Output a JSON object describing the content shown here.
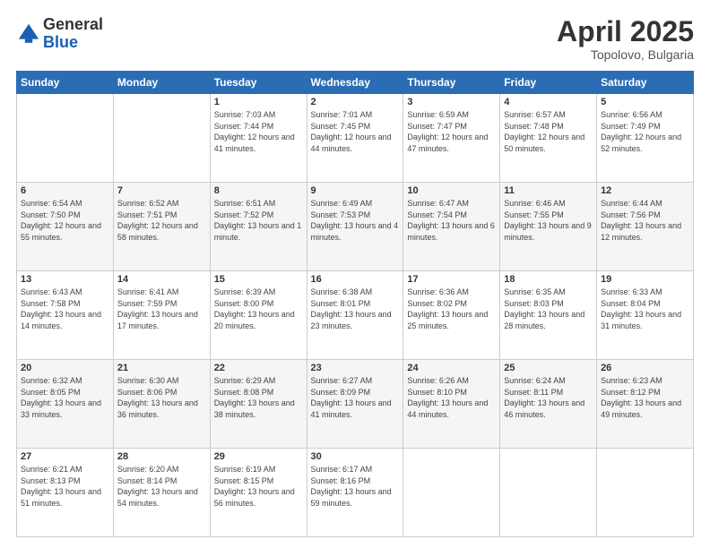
{
  "header": {
    "logo": {
      "general": "General",
      "blue": "Blue"
    },
    "title": "April 2025",
    "subtitle": "Topolovo, Bulgaria"
  },
  "days_of_week": [
    "Sunday",
    "Monday",
    "Tuesday",
    "Wednesday",
    "Thursday",
    "Friday",
    "Saturday"
  ],
  "weeks": [
    [
      {
        "day": "",
        "sunrise": "",
        "sunset": "",
        "daylight": ""
      },
      {
        "day": "",
        "sunrise": "",
        "sunset": "",
        "daylight": ""
      },
      {
        "day": "1",
        "sunrise": "Sunrise: 7:03 AM",
        "sunset": "Sunset: 7:44 PM",
        "daylight": "Daylight: 12 hours and 41 minutes."
      },
      {
        "day": "2",
        "sunrise": "Sunrise: 7:01 AM",
        "sunset": "Sunset: 7:45 PM",
        "daylight": "Daylight: 12 hours and 44 minutes."
      },
      {
        "day": "3",
        "sunrise": "Sunrise: 6:59 AM",
        "sunset": "Sunset: 7:47 PM",
        "daylight": "Daylight: 12 hours and 47 minutes."
      },
      {
        "day": "4",
        "sunrise": "Sunrise: 6:57 AM",
        "sunset": "Sunset: 7:48 PM",
        "daylight": "Daylight: 12 hours and 50 minutes."
      },
      {
        "day": "5",
        "sunrise": "Sunrise: 6:56 AM",
        "sunset": "Sunset: 7:49 PM",
        "daylight": "Daylight: 12 hours and 52 minutes."
      }
    ],
    [
      {
        "day": "6",
        "sunrise": "Sunrise: 6:54 AM",
        "sunset": "Sunset: 7:50 PM",
        "daylight": "Daylight: 12 hours and 55 minutes."
      },
      {
        "day": "7",
        "sunrise": "Sunrise: 6:52 AM",
        "sunset": "Sunset: 7:51 PM",
        "daylight": "Daylight: 12 hours and 58 minutes."
      },
      {
        "day": "8",
        "sunrise": "Sunrise: 6:51 AM",
        "sunset": "Sunset: 7:52 PM",
        "daylight": "Daylight: 13 hours and 1 minute."
      },
      {
        "day": "9",
        "sunrise": "Sunrise: 6:49 AM",
        "sunset": "Sunset: 7:53 PM",
        "daylight": "Daylight: 13 hours and 4 minutes."
      },
      {
        "day": "10",
        "sunrise": "Sunrise: 6:47 AM",
        "sunset": "Sunset: 7:54 PM",
        "daylight": "Daylight: 13 hours and 6 minutes."
      },
      {
        "day": "11",
        "sunrise": "Sunrise: 6:46 AM",
        "sunset": "Sunset: 7:55 PM",
        "daylight": "Daylight: 13 hours and 9 minutes."
      },
      {
        "day": "12",
        "sunrise": "Sunrise: 6:44 AM",
        "sunset": "Sunset: 7:56 PM",
        "daylight": "Daylight: 13 hours and 12 minutes."
      }
    ],
    [
      {
        "day": "13",
        "sunrise": "Sunrise: 6:43 AM",
        "sunset": "Sunset: 7:58 PM",
        "daylight": "Daylight: 13 hours and 14 minutes."
      },
      {
        "day": "14",
        "sunrise": "Sunrise: 6:41 AM",
        "sunset": "Sunset: 7:59 PM",
        "daylight": "Daylight: 13 hours and 17 minutes."
      },
      {
        "day": "15",
        "sunrise": "Sunrise: 6:39 AM",
        "sunset": "Sunset: 8:00 PM",
        "daylight": "Daylight: 13 hours and 20 minutes."
      },
      {
        "day": "16",
        "sunrise": "Sunrise: 6:38 AM",
        "sunset": "Sunset: 8:01 PM",
        "daylight": "Daylight: 13 hours and 23 minutes."
      },
      {
        "day": "17",
        "sunrise": "Sunrise: 6:36 AM",
        "sunset": "Sunset: 8:02 PM",
        "daylight": "Daylight: 13 hours and 25 minutes."
      },
      {
        "day": "18",
        "sunrise": "Sunrise: 6:35 AM",
        "sunset": "Sunset: 8:03 PM",
        "daylight": "Daylight: 13 hours and 28 minutes."
      },
      {
        "day": "19",
        "sunrise": "Sunrise: 6:33 AM",
        "sunset": "Sunset: 8:04 PM",
        "daylight": "Daylight: 13 hours and 31 minutes."
      }
    ],
    [
      {
        "day": "20",
        "sunrise": "Sunrise: 6:32 AM",
        "sunset": "Sunset: 8:05 PM",
        "daylight": "Daylight: 13 hours and 33 minutes."
      },
      {
        "day": "21",
        "sunrise": "Sunrise: 6:30 AM",
        "sunset": "Sunset: 8:06 PM",
        "daylight": "Daylight: 13 hours and 36 minutes."
      },
      {
        "day": "22",
        "sunrise": "Sunrise: 6:29 AM",
        "sunset": "Sunset: 8:08 PM",
        "daylight": "Daylight: 13 hours and 38 minutes."
      },
      {
        "day": "23",
        "sunrise": "Sunrise: 6:27 AM",
        "sunset": "Sunset: 8:09 PM",
        "daylight": "Daylight: 13 hours and 41 minutes."
      },
      {
        "day": "24",
        "sunrise": "Sunrise: 6:26 AM",
        "sunset": "Sunset: 8:10 PM",
        "daylight": "Daylight: 13 hours and 44 minutes."
      },
      {
        "day": "25",
        "sunrise": "Sunrise: 6:24 AM",
        "sunset": "Sunset: 8:11 PM",
        "daylight": "Daylight: 13 hours and 46 minutes."
      },
      {
        "day": "26",
        "sunrise": "Sunrise: 6:23 AM",
        "sunset": "Sunset: 8:12 PM",
        "daylight": "Daylight: 13 hours and 49 minutes."
      }
    ],
    [
      {
        "day": "27",
        "sunrise": "Sunrise: 6:21 AM",
        "sunset": "Sunset: 8:13 PM",
        "daylight": "Daylight: 13 hours and 51 minutes."
      },
      {
        "day": "28",
        "sunrise": "Sunrise: 6:20 AM",
        "sunset": "Sunset: 8:14 PM",
        "daylight": "Daylight: 13 hours and 54 minutes."
      },
      {
        "day": "29",
        "sunrise": "Sunrise: 6:19 AM",
        "sunset": "Sunset: 8:15 PM",
        "daylight": "Daylight: 13 hours and 56 minutes."
      },
      {
        "day": "30",
        "sunrise": "Sunrise: 6:17 AM",
        "sunset": "Sunset: 8:16 PM",
        "daylight": "Daylight: 13 hours and 59 minutes."
      },
      {
        "day": "",
        "sunrise": "",
        "sunset": "",
        "daylight": ""
      },
      {
        "day": "",
        "sunrise": "",
        "sunset": "",
        "daylight": ""
      },
      {
        "day": "",
        "sunrise": "",
        "sunset": "",
        "daylight": ""
      }
    ]
  ]
}
